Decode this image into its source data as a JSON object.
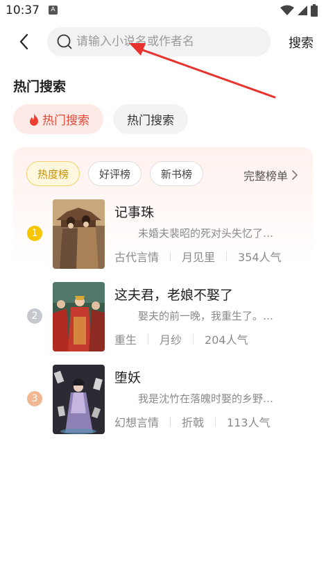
{
  "status_bar": {
    "time": "10:37",
    "notification_letter": "A"
  },
  "header": {
    "search_placeholder": "请输入小说名或作者名",
    "search_button": "搜索"
  },
  "hot_search": {
    "title": "热门搜索",
    "chips": [
      {
        "label": "热门搜索",
        "active": true
      },
      {
        "label": "热门搜索",
        "active": false
      }
    ]
  },
  "ranking": {
    "tabs": [
      {
        "label": "热度榜",
        "active": true
      },
      {
        "label": "好评榜",
        "active": false
      },
      {
        "label": "新书榜",
        "active": false
      }
    ],
    "full_list": "完整榜单",
    "rank_colors": [
      "#f7c600",
      "#c6c8cf",
      "#f0b790"
    ],
    "books": [
      {
        "rank": "1",
        "title": "记事珠",
        "desc": "未婚夫裴昭的死对头失忆了…",
        "genre": "古代言情",
        "author": "月见里",
        "popularity": "354人气"
      },
      {
        "rank": "2",
        "title": "这夫君，老娘不娶了",
        "desc": "娶夫的前一晚，我重生了。…",
        "genre": "重生",
        "author": "月纱",
        "popularity": "204人气"
      },
      {
        "rank": "3",
        "title": "堕妖",
        "desc": "我是沈竹在落魄时娶的乡野…",
        "genre": "幻想言情",
        "author": "折戟",
        "popularity": "113人气"
      }
    ]
  },
  "annotation": {
    "arrow_color": "#e8322d"
  }
}
